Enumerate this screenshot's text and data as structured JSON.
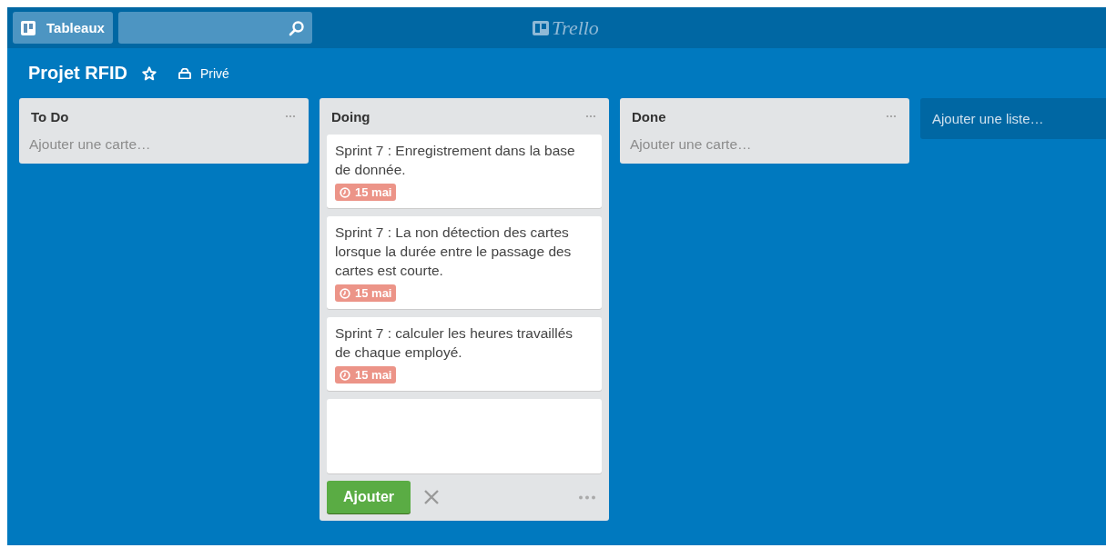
{
  "header": {
    "boards_button": "Tableaux",
    "logo": "Trello"
  },
  "board": {
    "title": "Projet RFID",
    "starred": false,
    "visibility": "Privé"
  },
  "lists": [
    {
      "title": "To Do",
      "add_card": "Ajouter une carte…"
    },
    {
      "title": "Doing",
      "cards": [
        {
          "text": "Sprint 7 : Enregistrement dans la base de donnée.",
          "due": {
            "label": "15 mai",
            "overdue": true
          }
        },
        {
          "text": "Sprint 7 : La non détection des cartes lorsque la durée entre le passage des cartes est courte.",
          "due": {
            "label": "15 mai",
            "overdue": true
          }
        },
        {
          "text": "Sprint 7 : calculer les heures travaillés de chaque employé.",
          "due": {
            "label": "15 mai",
            "overdue": true
          }
        }
      ],
      "composer": {
        "button": "Ajouter"
      }
    },
    {
      "title": "Done",
      "add_card": "Ajouter une carte…"
    }
  ],
  "add_list": "Ajouter une liste…"
}
